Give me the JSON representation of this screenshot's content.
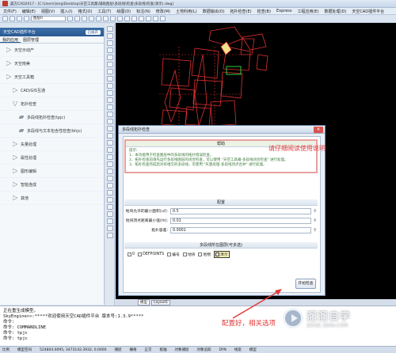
{
  "titlebar": {
    "title": "晨方CAD2017 - [C:\\Users\\long\\Desktop\\天空工具集\\辅助图层\\多段线\\检查\\多段线\\检查(演示).dwg]"
  },
  "menubar": {
    "items": [
      "文件(F)",
      "编辑(E)",
      "视图(V)",
      "插入(I)",
      "格式(O)",
      "工具(T)",
      "绘图(D)",
      "标注(N)",
      "修改(M)",
      "土地利用(L)",
      "数据输出(O)",
      "拓扑检查(E)",
      "检查(B)",
      "Express",
      "工程应用(E)",
      "数据处理(D)",
      "天空CAD插件平台"
    ]
  },
  "toolbar": {
    "layer_select": "图层0"
  },
  "leftpanel": {
    "header": "天空CAD插件平台",
    "expand_label": "已展开",
    "tabs": [
      "我的应用",
      "图层管理"
    ],
    "items": [
      {
        "label": "天空示动产",
        "level": 0
      },
      {
        "label": "天空南美",
        "level": 0
      },
      {
        "label": "天空工具箱",
        "level": 0
      },
      {
        "label": "CAD/GIS互通",
        "level": 1
      },
      {
        "label": "拓扑检查",
        "level": 1
      },
      {
        "label": "多段线拓扑检查(tpjc)",
        "level": 2
      },
      {
        "label": "多段线与文本包含性检查(bhjc)",
        "level": 2
      },
      {
        "label": "矢量处理",
        "level": 1
      },
      {
        "label": "属性处理",
        "level": 1
      },
      {
        "label": "图形编辑",
        "level": 1
      },
      {
        "label": "智能连成",
        "level": 1
      },
      {
        "label": "其他",
        "level": 1
      }
    ]
  },
  "canvas": {
    "tabs": [
      "模型",
      "Layout1"
    ],
    "drawing_color": "#e03030"
  },
  "dialog": {
    "title": "多段线拓扑检查",
    "help": {
      "header": "帮助",
      "overlay_note": "请仔细阅读使用说明",
      "lines": [
        "提示:",
        "1、本功能用于检查图层中的多段线的拓扑错误检查。",
        "2、拓扑检查前请先运行多段线图层的闭合检查，可以使用 \"天空工具箱-多段线闭合检查\" 进行处理。",
        "3、拓扑检查完成后对有相交的多段线，可使用 \"矢量处理-多段线顶点合并\" 进行处理。"
      ]
    },
    "config": {
      "header": "配置",
      "rows": [
        {
          "label": "地块允许的最小面积(㎡):",
          "value": "0.5"
        },
        {
          "label": "地块顶点距离最小值(m):",
          "value": "0.01"
        },
        {
          "label": "拓扑容差:",
          "value": "0.0001"
        }
      ]
    },
    "layers": {
      "header": "多段线所在图层(可多选)",
      "options": [
        {
          "label": "0",
          "selected": false
        },
        {
          "label": "DEFPOINTS",
          "selected": false
        },
        {
          "label": "编号",
          "selected": false
        },
        {
          "label": "地块",
          "selected": false
        },
        {
          "label": "地物",
          "selected": false
        },
        {
          "label": "演示",
          "selected": true
        }
      ]
    },
    "start_button": "开始检查"
  },
  "command": {
    "lines": [
      "正在重生成模型。",
      "SkyEngine>>:*****欢迎使用天空CAD插件平台 版本号:1.3.9*****",
      "命令:",
      "命令: COMMANDLINE",
      "命令: tpjc",
      "命令: tpjc"
    ]
  },
  "annotation": {
    "text": "配置好，相关选项"
  },
  "watermark": {
    "brand": "溜溜自学",
    "url": "ZIXUE.3D66.COM"
  },
  "statusbar": {
    "items": [
      "比例",
      "模型空间",
      "524804.0095, 3473142.3932, 0.0000",
      "捕捉",
      "栅格",
      "正交",
      "极轴",
      "对象捕捉",
      "对象追踪",
      "DYN",
      "线宽",
      "模型"
    ]
  }
}
